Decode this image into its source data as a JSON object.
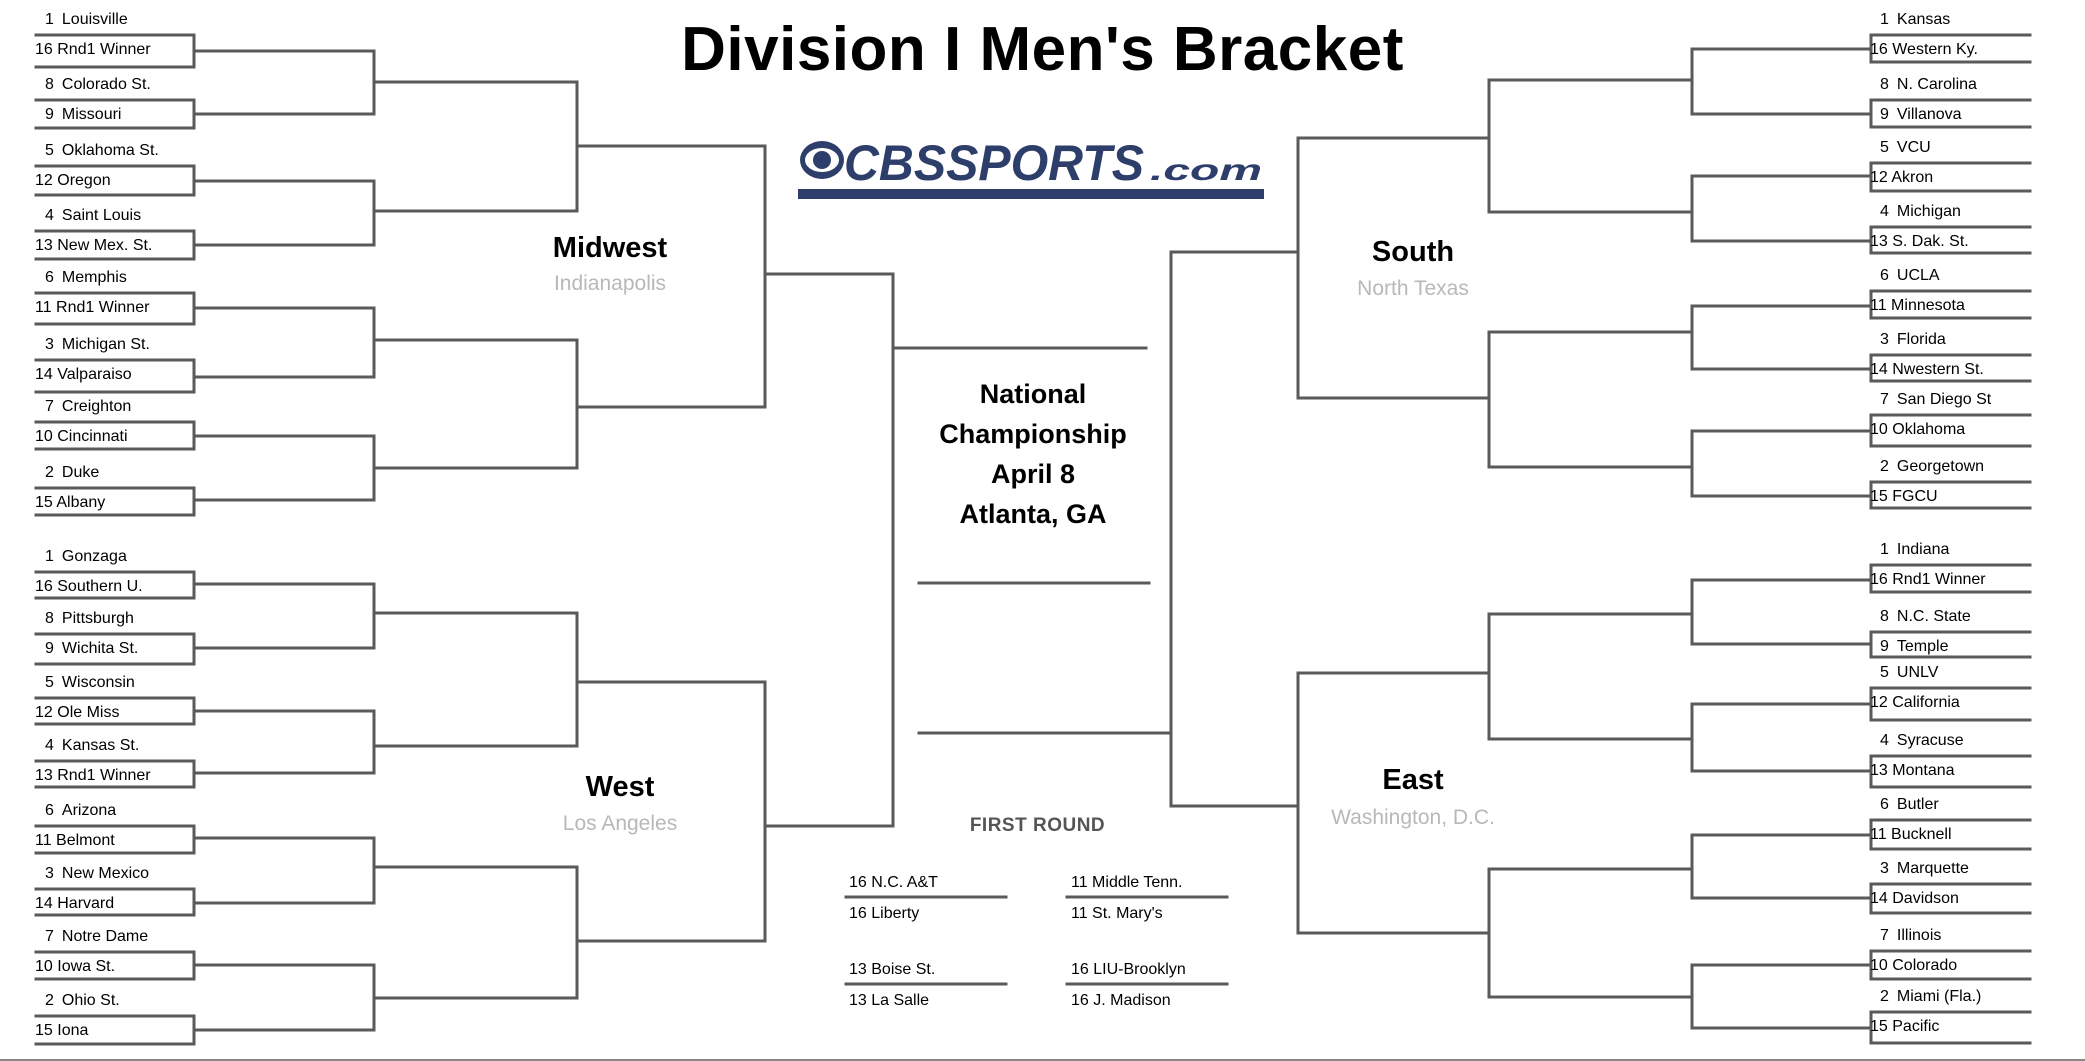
{
  "title": "Division I Men's Bracket",
  "logo": {
    "text_main": "CBSSPORTS",
    "text_suffix": ".com",
    "color": "#2d3e6b"
  },
  "championship": {
    "lines": [
      "National",
      "Championship",
      "April 8",
      "Atlanta, GA"
    ]
  },
  "regions": {
    "midwest": {
      "name": "Midwest",
      "city": "Indianapolis",
      "teams": [
        {
          "seed": "1",
          "name": "Louisville"
        },
        {
          "seed": "16",
          "name": "Rnd1 Winner"
        },
        {
          "seed": "8",
          "name": "Colorado St."
        },
        {
          "seed": "9",
          "name": "Missouri"
        },
        {
          "seed": "5",
          "name": "Oklahoma St."
        },
        {
          "seed": "12",
          "name": "Oregon"
        },
        {
          "seed": "4",
          "name": "Saint Louis"
        },
        {
          "seed": "13",
          "name": "New Mex. St."
        },
        {
          "seed": "6",
          "name": "Memphis"
        },
        {
          "seed": "11",
          "name": "Rnd1 Winner"
        },
        {
          "seed": "3",
          "name": "Michigan St."
        },
        {
          "seed": "14",
          "name": "Valparaiso"
        },
        {
          "seed": "7",
          "name": "Creighton"
        },
        {
          "seed": "10",
          "name": "Cincinnati"
        },
        {
          "seed": "2",
          "name": "Duke"
        },
        {
          "seed": "15",
          "name": "Albany"
        }
      ]
    },
    "west": {
      "name": "West",
      "city": "Los Angeles",
      "teams": [
        {
          "seed": "1",
          "name": "Gonzaga"
        },
        {
          "seed": "16",
          "name": "Southern U."
        },
        {
          "seed": "8",
          "name": "Pittsburgh"
        },
        {
          "seed": "9",
          "name": "Wichita St."
        },
        {
          "seed": "5",
          "name": "Wisconsin"
        },
        {
          "seed": "12",
          "name": "Ole Miss"
        },
        {
          "seed": "4",
          "name": "Kansas St."
        },
        {
          "seed": "13",
          "name": "Rnd1 Winner"
        },
        {
          "seed": "6",
          "name": "Arizona"
        },
        {
          "seed": "11",
          "name": "Belmont"
        },
        {
          "seed": "3",
          "name": "New Mexico"
        },
        {
          "seed": "14",
          "name": "Harvard"
        },
        {
          "seed": "7",
          "name": "Notre Dame"
        },
        {
          "seed": "10",
          "name": "Iowa St."
        },
        {
          "seed": "2",
          "name": "Ohio St."
        },
        {
          "seed": "15",
          "name": "Iona"
        }
      ]
    },
    "south": {
      "name": "South",
      "city": "North Texas",
      "teams": [
        {
          "seed": "1",
          "name": "Kansas"
        },
        {
          "seed": "16",
          "name": "Western Ky."
        },
        {
          "seed": "8",
          "name": "N. Carolina"
        },
        {
          "seed": "9",
          "name": "Villanova"
        },
        {
          "seed": "5",
          "name": "VCU"
        },
        {
          "seed": "12",
          "name": "Akron"
        },
        {
          "seed": "4",
          "name": "Michigan"
        },
        {
          "seed": "13",
          "name": "S. Dak. St."
        },
        {
          "seed": "6",
          "name": "UCLA"
        },
        {
          "seed": "11",
          "name": "Minnesota"
        },
        {
          "seed": "3",
          "name": "Florida"
        },
        {
          "seed": "14",
          "name": "Nwestern St."
        },
        {
          "seed": "7",
          "name": "San Diego St"
        },
        {
          "seed": "10",
          "name": "Oklahoma"
        },
        {
          "seed": "2",
          "name": "Georgetown"
        },
        {
          "seed": "15",
          "name": "FGCU"
        }
      ]
    },
    "east": {
      "name": "East",
      "city": "Washington, D.C.",
      "teams": [
        {
          "seed": "1",
          "name": "Indiana"
        },
        {
          "seed": "16",
          "name": "Rnd1 Winner"
        },
        {
          "seed": "8",
          "name": "N.C. State"
        },
        {
          "seed": "9",
          "name": "Temple"
        },
        {
          "seed": "5",
          "name": "UNLV"
        },
        {
          "seed": "12",
          "name": "California"
        },
        {
          "seed": "4",
          "name": "Syracuse"
        },
        {
          "seed": "13",
          "name": "Montana"
        },
        {
          "seed": "6",
          "name": "Butler"
        },
        {
          "seed": "11",
          "name": "Bucknell"
        },
        {
          "seed": "3",
          "name": "Marquette"
        },
        {
          "seed": "14",
          "name": "Davidson"
        },
        {
          "seed": "7",
          "name": "Illinois"
        },
        {
          "seed": "10",
          "name": "Colorado"
        },
        {
          "seed": "2",
          "name": "Miami (Fla.)"
        },
        {
          "seed": "15",
          "name": "Pacific"
        }
      ]
    }
  },
  "first_round": {
    "title": "FIRST ROUND",
    "games": [
      {
        "top": "16 N.C. A&T",
        "bottom": "16 Liberty"
      },
      {
        "top": "11 Middle Tenn.",
        "bottom": "11 St. Mary's"
      },
      {
        "top": "13 Boise St.",
        "bottom": "13 La Salle"
      },
      {
        "top": "16 LIU-Brooklyn",
        "bottom": "16 J. Madison"
      }
    ]
  }
}
